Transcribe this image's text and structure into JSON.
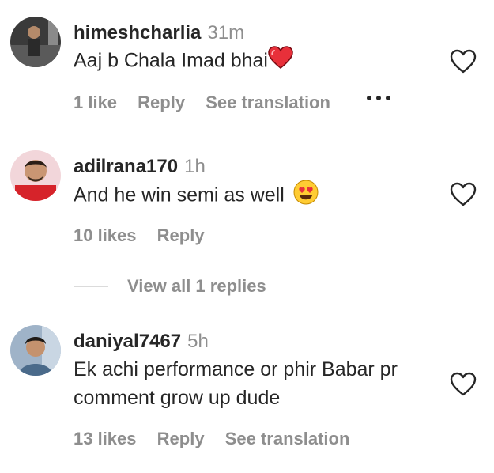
{
  "comments": [
    {
      "username": "himeshcharlia",
      "time": "31m",
      "text": "Aaj b Chala Imad bhai",
      "emoji": "heart-emoji",
      "likes": "1 like",
      "reply": "Reply",
      "translation": "See translation"
    },
    {
      "username": "adilrana170",
      "time": "1h",
      "text": "And he win semi as well",
      "emoji": "heart-eyes-emoji",
      "likes": "10 likes",
      "reply": "Reply",
      "view_replies": "View all 1 replies"
    },
    {
      "username": "daniyal7467",
      "time": "5h",
      "text_line1": "Ek achi performance or phir Babar pr",
      "text_line2": "comment grow up dude",
      "likes": "13 likes",
      "reply": "Reply",
      "translation": "See translation"
    }
  ],
  "colors": {
    "primary_text": "#262626",
    "secondary_text": "#8e8e8e",
    "heart_red": "#ed4956",
    "divider": "#dbdbdb"
  },
  "icons": [
    "heart-outline-icon",
    "more-options-icon"
  ]
}
